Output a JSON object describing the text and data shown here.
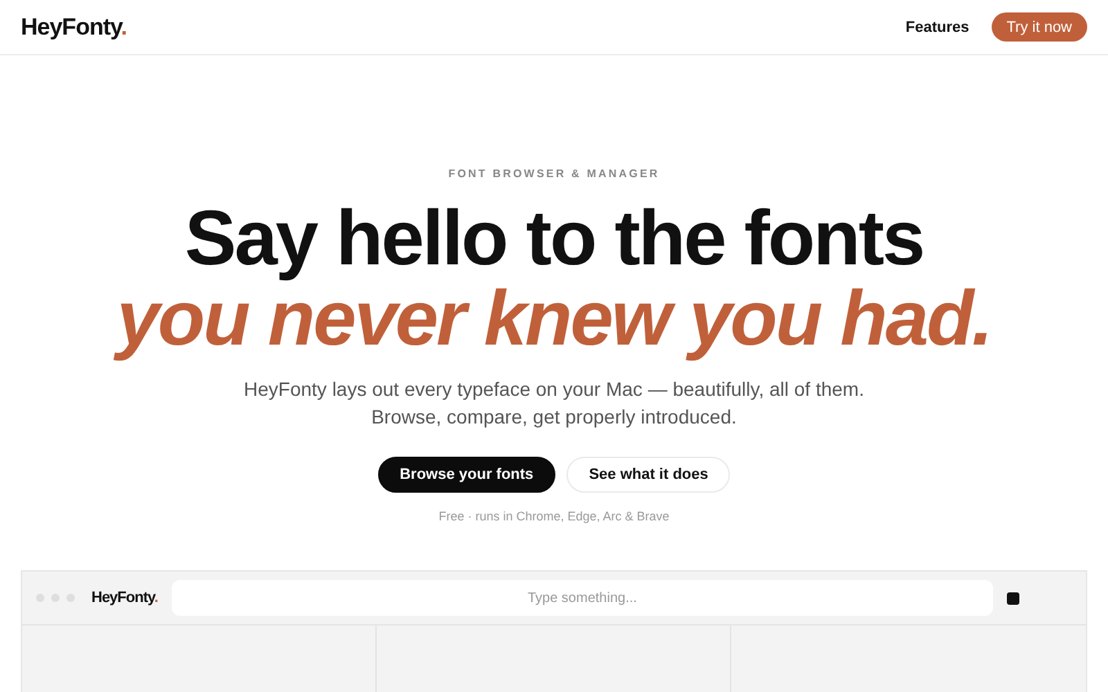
{
  "nav": {
    "logo": {
      "name": "HeyFonty",
      "dot": "."
    },
    "links": [
      "Features"
    ],
    "cta": "Try it now"
  },
  "hero": {
    "eyebrow": "FONT BROWSER & MANAGER",
    "title": "Say hello to the fonts",
    "title_accent": "you never knew you had.",
    "lead": [
      "HeyFonty lays out every typeface on your Mac — beautifully, all of them.",
      "Browse, compare, get properly introduced."
    ],
    "primary": "Browse your fonts",
    "secondary": "See what it does",
    "note": "Free · runs in Chrome, Edge, Arc & Brave"
  },
  "preview": {
    "logo": {
      "name": "HeyFonty",
      "dot": "."
    },
    "search": {
      "placeholder": "Type something..."
    }
  }
}
